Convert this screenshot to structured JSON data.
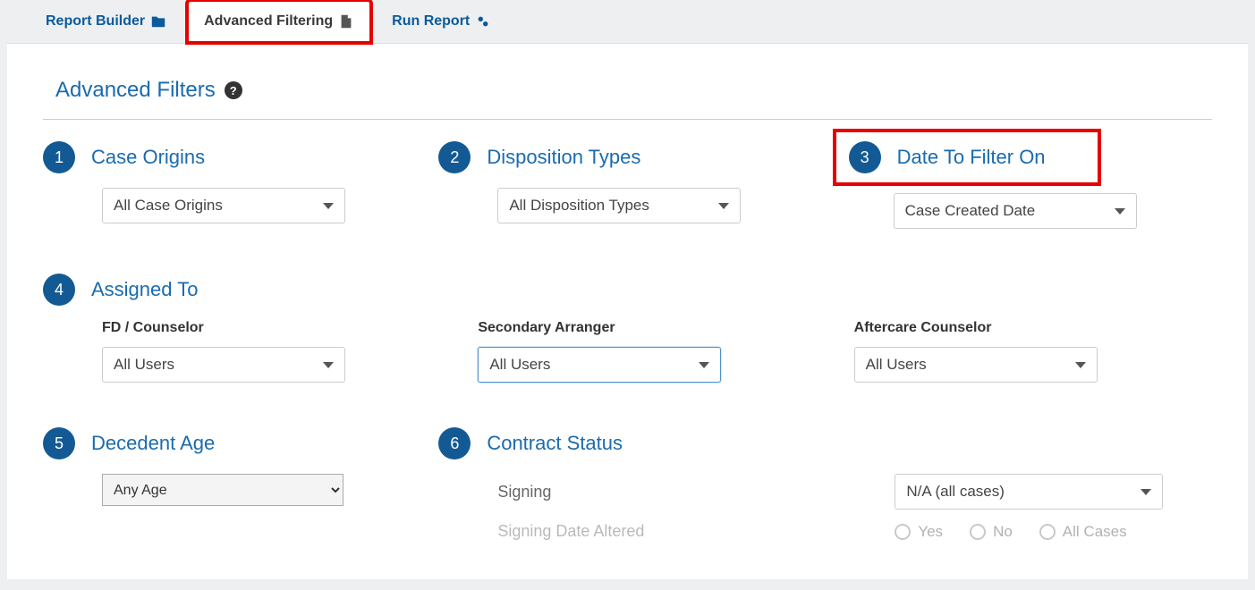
{
  "tabs": [
    {
      "label": "Report Builder"
    },
    {
      "label": "Advanced Filtering"
    },
    {
      "label": "Run Report"
    }
  ],
  "section_title": "Advanced Filters",
  "filters": {
    "case_origins": {
      "num": "1",
      "title": "Case Origins",
      "select": "All Case Origins"
    },
    "disposition_types": {
      "num": "2",
      "title": "Disposition Types",
      "select": "All Disposition Types"
    },
    "date_filter_on": {
      "num": "3",
      "title": "Date To Filter On",
      "select": "Case Created Date"
    },
    "assigned_to": {
      "num": "4",
      "title": "Assigned To",
      "fd": {
        "label": "FD / Counselor",
        "value": "All Users"
      },
      "secondary": {
        "label": "Secondary Arranger",
        "value": "All Users"
      },
      "aftercare": {
        "label": "Aftercare Counselor",
        "value": "All Users"
      }
    },
    "decedent_age": {
      "num": "5",
      "title": "Decedent Age",
      "select": "Any Age"
    },
    "contract_status": {
      "num": "6",
      "title": "Contract Status",
      "signing_label": "Signing",
      "signing_select": "N/A (all cases)",
      "alt_label": "Signing Date Altered",
      "radios": {
        "yes": "Yes",
        "no": "No",
        "all": "All Cases"
      }
    }
  }
}
